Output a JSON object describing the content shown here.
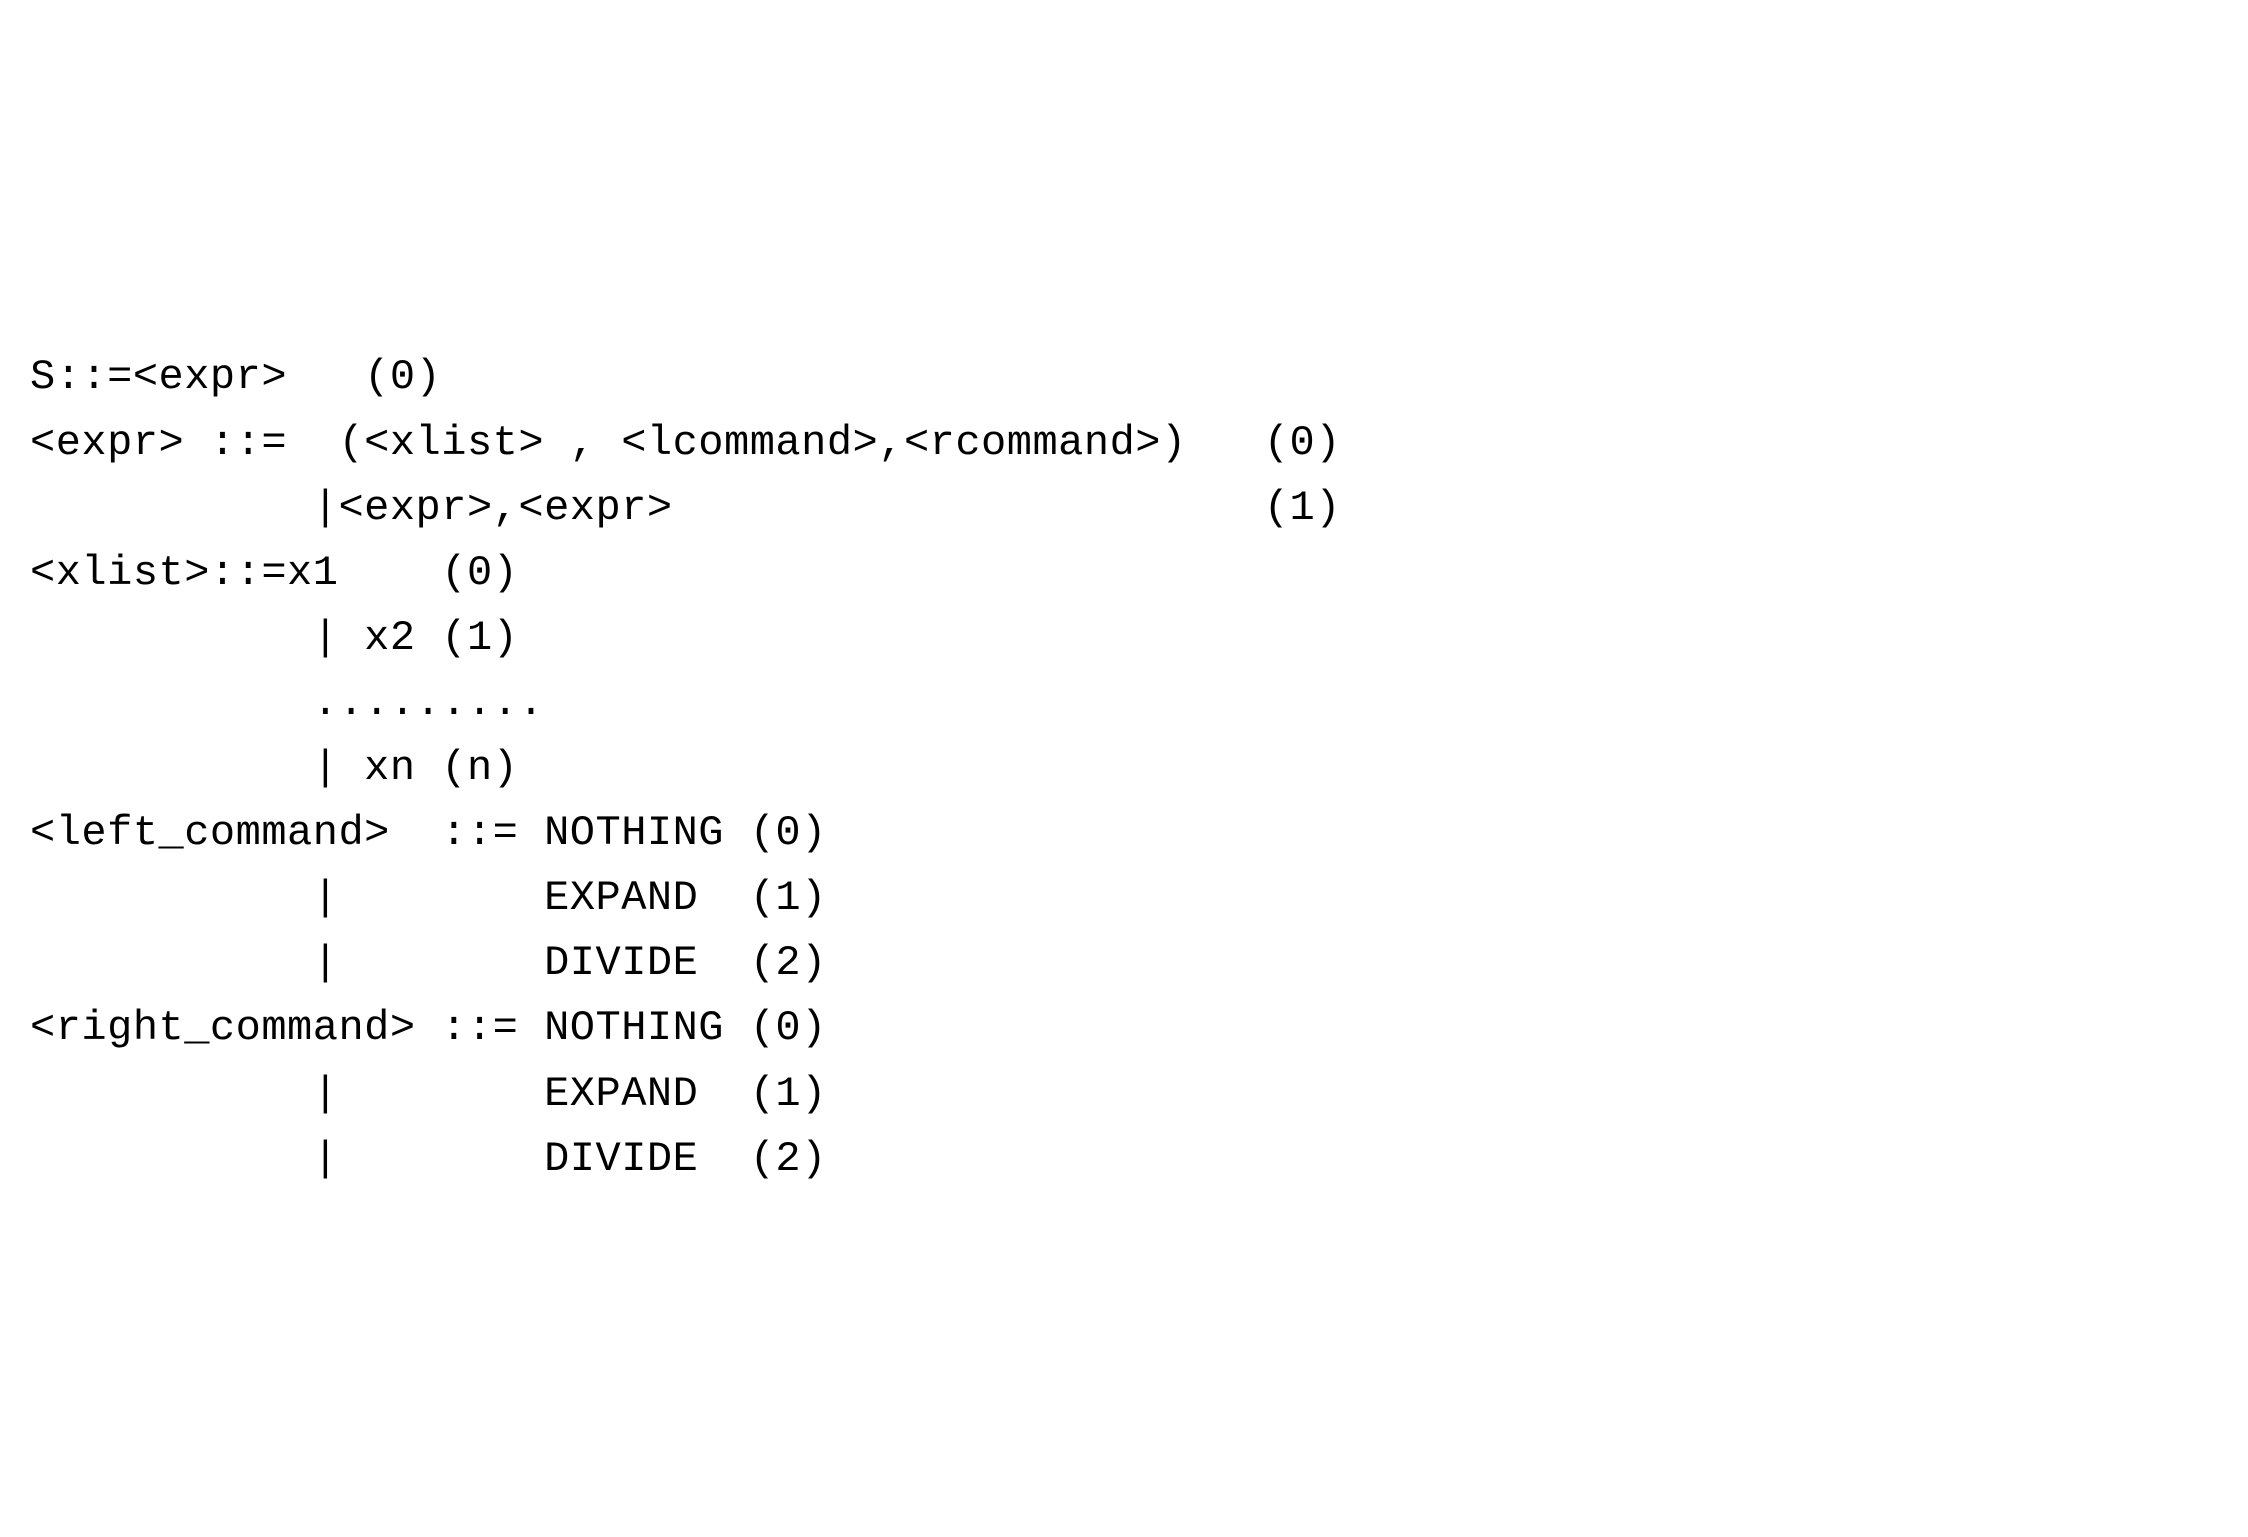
{
  "grammar": {
    "lines": [
      "S::=<expr>   (0)",
      "<expr> ::=  (<xlist> , <lcommand>,<rcommand>)   (0)",
      "           |<expr>,<expr>                       (1)",
      "<xlist>::=x1    (0)",
      "           | x2 (1)",
      "           .........",
      "           | xn (n)",
      "<left_command>  ::= NOTHING (0)",
      "           |        EXPAND  (1)",
      "           |        DIVIDE  (2)",
      "<right_command> ::= NOTHING (0)",
      "           |        EXPAND  (1)",
      "           |        DIVIDE  (2)"
    ]
  }
}
